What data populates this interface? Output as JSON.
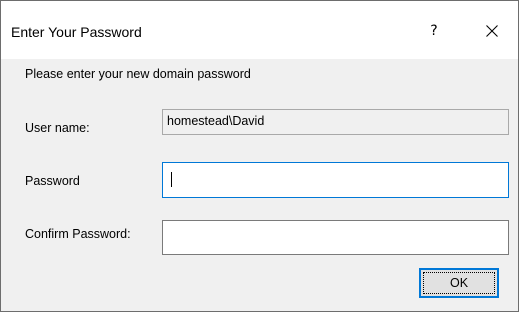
{
  "window": {
    "title": "Enter Your Password",
    "help_glyph": "?",
    "help_icon": "question-mark-icon",
    "close_icon": "close-icon"
  },
  "form": {
    "prompt": "Please enter your new domain password",
    "username_label": "User name:",
    "username_value": "homestead\\David",
    "password_label": "Password",
    "password_value": "",
    "confirm_label": "Confirm Password:",
    "confirm_value": ""
  },
  "buttons": {
    "ok_label": "OK"
  },
  "colors": {
    "dialog_background": "#f0f0f0",
    "title_bar": "#ffffff",
    "accent": "#0078d7"
  }
}
